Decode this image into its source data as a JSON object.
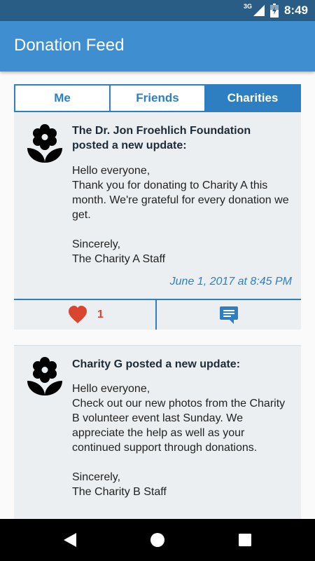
{
  "status_bar": {
    "network": "3G",
    "time": "8:49"
  },
  "app_bar": {
    "title": "Donation Feed"
  },
  "tabs": [
    {
      "label": "Me",
      "active": false
    },
    {
      "label": "Friends",
      "active": false
    },
    {
      "label": "Charities",
      "active": true
    }
  ],
  "posts": [
    {
      "author_line": "The Dr. Jon Froehlich Foundation posted a new update:",
      "greeting": "Hello everyone,",
      "message": "Thank you for donating to Charity A this month. We're grateful for every donation we get.",
      "closing": "Sincerely,",
      "signature": "The Charity A Staff",
      "date": "June 1, 2017 at 8:45 PM",
      "likes": "1",
      "avatar_icon": "flower-icon"
    },
    {
      "author_line": "Charity G posted a new update:",
      "greeting": "Hello everyone,",
      "message": "Check out our new photos from the Charity B volunteer event last Sunday. We appreciate the help as well as your continued support through donations.",
      "closing": "Sincerely,",
      "signature": "The Charity B Staff",
      "avatar_icon": "flower-icon"
    }
  ],
  "icons": {
    "like": "heart-icon",
    "comment": "comment-icon",
    "back": "back-icon",
    "home": "home-icon",
    "recents": "recents-icon"
  },
  "colors": {
    "status_bar": "#2a5d85",
    "app_bar": "#3e8ed0",
    "accent": "#2d7fc1",
    "like": "#d9452f",
    "card_bg": "#eceff1"
  }
}
